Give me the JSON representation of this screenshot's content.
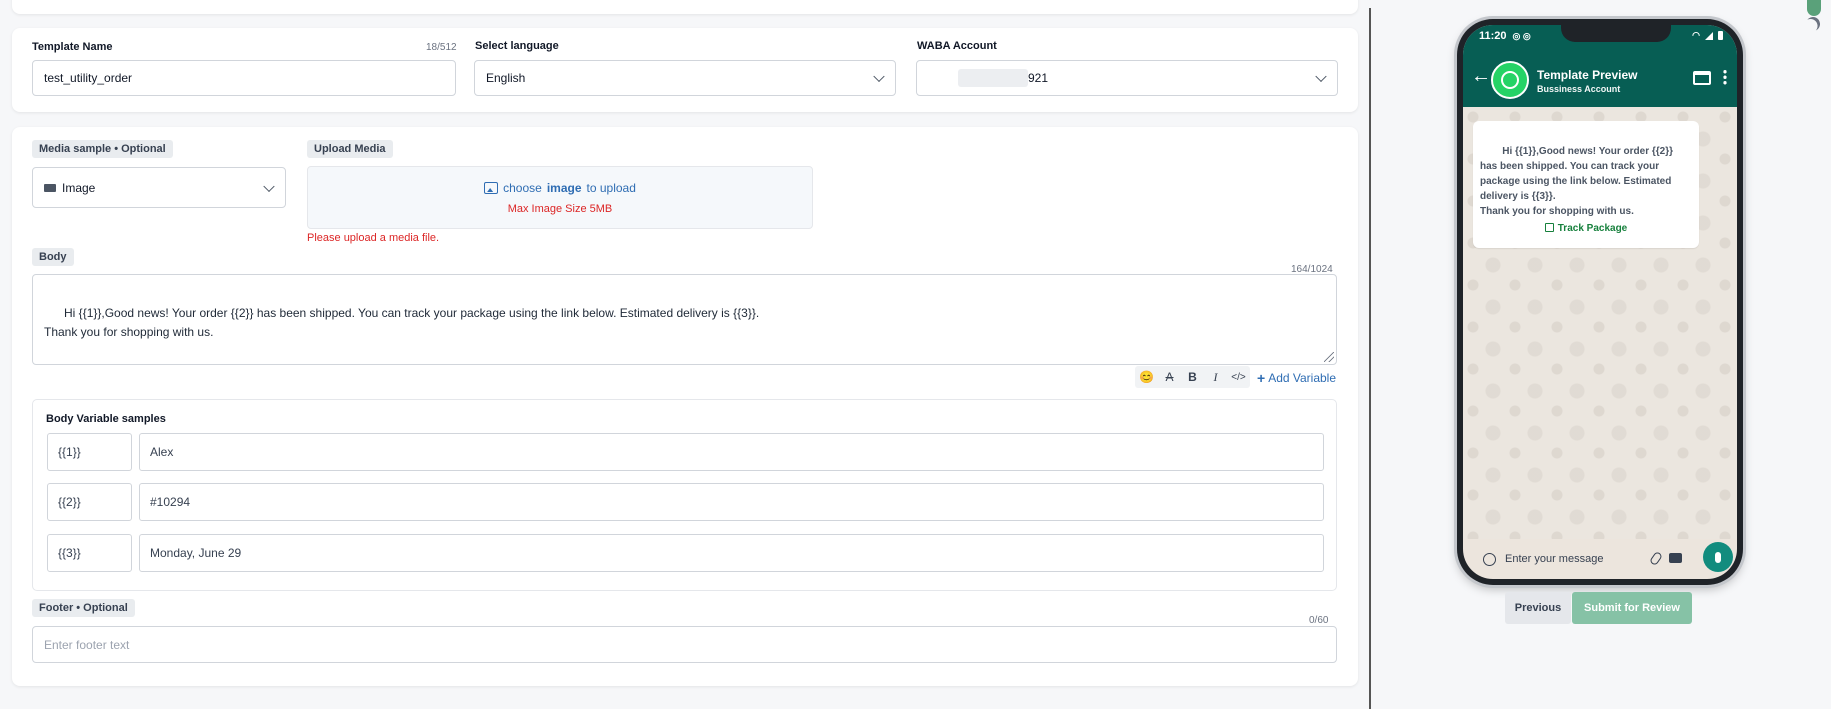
{
  "form": {
    "template_name": {
      "label": "Template Name",
      "counter": "18/512",
      "value": "test_utility_order"
    },
    "language": {
      "label": "Select language",
      "value": "English"
    },
    "waba": {
      "label": "WABA Account",
      "value": "921"
    },
    "media": {
      "label": "Media sample • Optional",
      "value": "Image",
      "icon": "image-icon"
    },
    "upload": {
      "label": "Upload Media",
      "choose": "choose",
      "image": "image",
      "to_upload": "to upload",
      "max": "Max Image Size 5MB",
      "error": "Please upload a media file."
    },
    "body": {
      "label": "Body",
      "counter": "164/1024",
      "text": "Hi {{1}},Good news! Your order {{2}} has been shipped. You can track your package using the link below. Estimated delivery is {{3}}.\nThank you for shopping with us."
    },
    "toolbar": {
      "emoji": "😊",
      "strike": "A",
      "bold": "B",
      "italic": "I",
      "code": "</>",
      "add_variable": "Add Variable"
    },
    "variables": {
      "title": "Body Variable samples",
      "rows": [
        {
          "key": "{{1}}",
          "value": "Alex"
        },
        {
          "key": "{{2}}",
          "value": "#10294"
        },
        {
          "key": "{{3}}",
          "value": "Monday, June 29"
        }
      ]
    },
    "footer": {
      "label": "Footer • Optional",
      "counter": "0/60",
      "placeholder": "Enter footer text"
    }
  },
  "preview": {
    "time": "11:20",
    "title": "Template Preview",
    "subtitle": "Bussiness Account",
    "message": "Hi {{1}},Good news! Your order {{2}} has been shipped. You can track your package using the link below. Estimated delivery is {{3}}.\nThank you for shopping with us.",
    "button": "Track Package",
    "input_placeholder": "Enter your message"
  },
  "actions": {
    "previous": "Previous",
    "submit": "Submit for Review"
  },
  "colors": {
    "whatsapp_green": "#075e54",
    "accent_blue": "#2f6db3",
    "error_red": "#dc2626",
    "submit_disabled": "#86c2a6"
  }
}
